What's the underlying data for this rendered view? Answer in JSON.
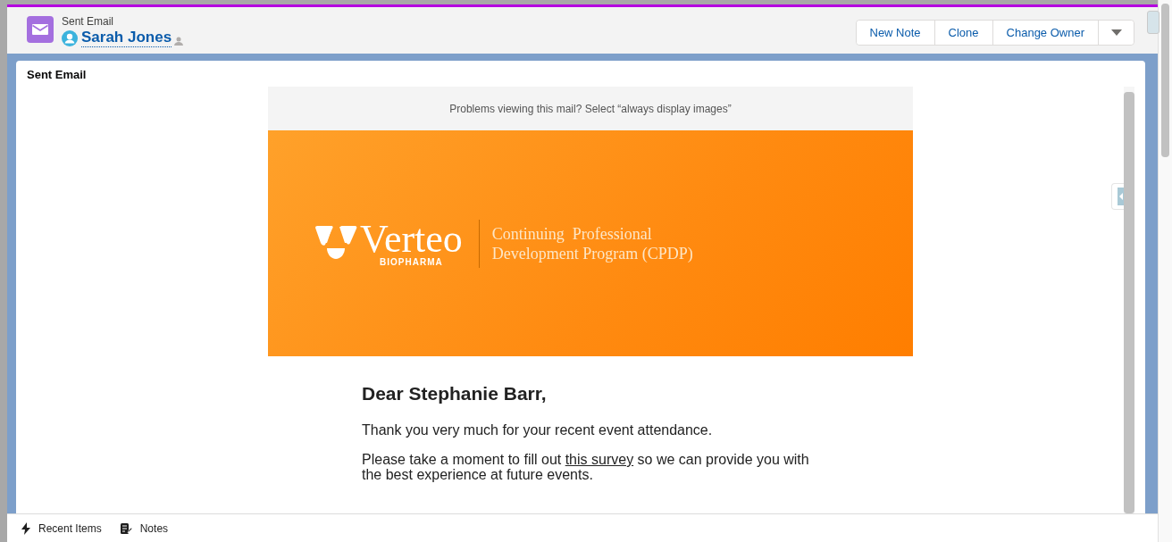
{
  "header": {
    "object_type": "Sent Email",
    "record_name": "Sarah Jones"
  },
  "actions": [
    {
      "label": "New Note",
      "kind": "button"
    },
    {
      "label": "Clone",
      "kind": "button"
    },
    {
      "label": "Change Owner",
      "kind": "button"
    },
    {
      "kind": "menu"
    }
  ],
  "card": {
    "title": "Sent Email"
  },
  "email": {
    "notice": "Problems viewing this mail? Select “always display images”",
    "banner": {
      "logo_name": "Verteo",
      "logo_sub": "BIOPHARMA",
      "tagline": [
        "Continuing  Professional",
        "Development Program (CPDP)"
      ]
    },
    "greeting": "Dear Stephanie Barr,",
    "paragraphs": [
      {
        "parts": [
          {
            "text": "Thank you very much for your recent event attendance."
          }
        ]
      },
      {
        "parts": [
          {
            "text": "Please take a moment to fill out "
          },
          {
            "text": "this survey",
            "link": true
          },
          {
            "text": " so we can provide you with the best experience at future events."
          }
        ]
      }
    ]
  },
  "footer": [
    {
      "label": "Recent Items",
      "kind": "recent"
    },
    {
      "label": "Notes",
      "kind": "notes"
    }
  ]
}
